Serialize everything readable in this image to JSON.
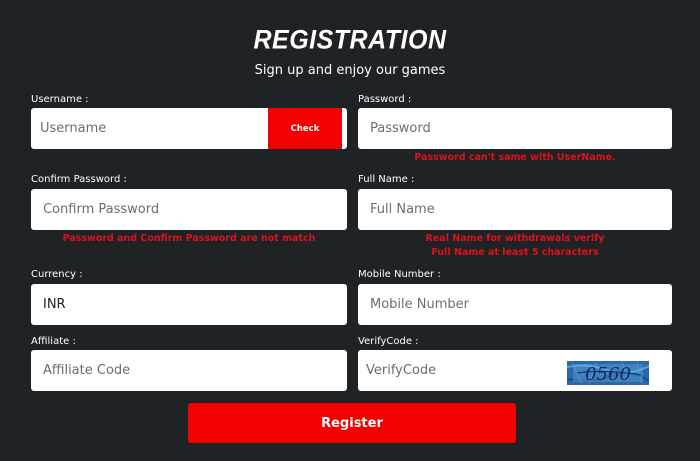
{
  "header": {
    "title": "REGISTRATION",
    "subtitle": "Sign up and enjoy our games"
  },
  "form": {
    "username": {
      "label": "Username :",
      "placeholder": "Username",
      "check_label": "Check"
    },
    "password": {
      "label": "Password :",
      "placeholder": "Password",
      "error": "Password can't same with UserName."
    },
    "confirm_password": {
      "label": "Confirm Password :",
      "placeholder": "Confirm Password",
      "error": "Password and Confirm Password are not match"
    },
    "full_name": {
      "label": "Full Name :",
      "placeholder": "Full Name",
      "error_line1": "Real Name for withdrawals verify",
      "error_line2": "Full Name at least 5 characters"
    },
    "currency": {
      "label": "Currency :",
      "value": "INR"
    },
    "mobile": {
      "label": "Mobile Number :",
      "placeholder": "Mobile Number"
    },
    "affiliate": {
      "label": "Affiliate :",
      "placeholder": "Affiliate Code"
    },
    "verify_code": {
      "label": "VerifyCode :",
      "placeholder": "VerifyCode",
      "captcha_text": "0560"
    },
    "register_label": "Register"
  },
  "colors": {
    "background": "#202326",
    "accent": "#f40000",
    "error": "#e0101a"
  }
}
